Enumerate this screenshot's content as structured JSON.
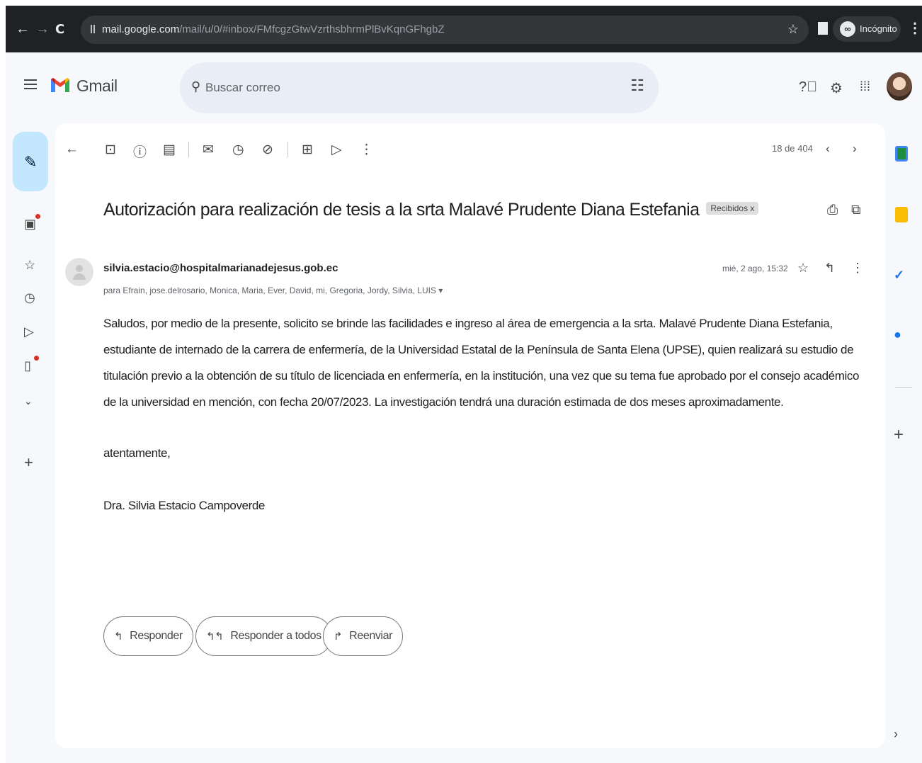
{
  "browser": {
    "url_host": "mail.google.com",
    "url_path": "/mail/u/0/#inbox/FMfcgzGtwVzrthsbhrmPlBvKqnGFhgbZ",
    "incognito_label": "Incógnito"
  },
  "app": {
    "name": "Gmail"
  },
  "search": {
    "placeholder": "Buscar correo"
  },
  "toolbar": {
    "pager": "18 de 404"
  },
  "message": {
    "subject": "Autorización para realización de tesis a la srta Malavé Prudente Diana Estefania",
    "label": "Recibidos x",
    "sender": "silvia.estacio@hospitalmarianadejesus.gob.ec",
    "recipients": "para Efrain, jose.delrosario, Monica, Maria, Ever, David, mi, Gregoria, Jordy, Silvia, LUIS ▾",
    "date": "mié, 2 ago, 15:32",
    "body": "Saludos, por medio de la presente, solicito se brinde las facilidades e ingreso al área de emergencia a la srta. Malavé Prudente Diana Estefania, estudiante de internado de la carrera de enfermería, de la Universidad Estatal de la Península de Santa Elena (UPSE), quien realizará su estudio de titulación previo a la obtención de su título de licenciada en enfermería, en la institución, una vez que su tema fue aprobado por el consejo académico de la universidad en mención, con fecha 20/07/2023. La investigación tendrá una duración estimada de  dos meses aproximadamente.",
    "closing": "atentamente,",
    "signature": "Dra. Silvia Estacio Campoverde"
  },
  "actions": {
    "reply": "Responder",
    "reply_all": "Responder a todos",
    "forward": "Reenviar"
  },
  "colors": {
    "chrome_bg": "#202124",
    "app_bg": "#f6f8fc",
    "compose_bg": "#c2e7ff",
    "search_bg": "#e9eef6",
    "notification_dot": "#d93025"
  }
}
